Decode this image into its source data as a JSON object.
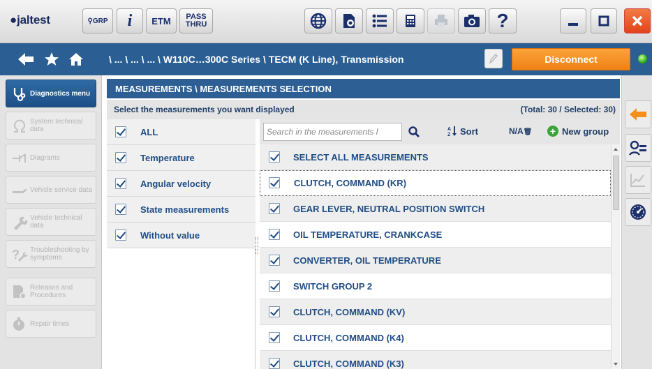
{
  "toolbar": {
    "logo_text": "jaltest",
    "grp_label": "GRP",
    "info_label": "i",
    "etm_label": "ETM",
    "pass_thru_line1": "PASS",
    "pass_thru_line2": "THRU",
    "help_label": "?"
  },
  "nav": {
    "breadcrumb": "\\ ... \\ ... \\ ... \\ W110C…300C Series \\ TECM (K Line), Transmission",
    "disconnect_label": "Disconnect"
  },
  "sidebar": {
    "items": [
      {
        "label": "Diagnostics menu",
        "active": true
      },
      {
        "label": "System technical data",
        "active": false
      },
      {
        "label": "Diagrams",
        "active": false
      },
      {
        "label": "Vehicle service data",
        "active": false
      },
      {
        "label": "Vehicle technical data",
        "active": false
      },
      {
        "label": "Troubleshooting by symptoms",
        "active": false
      },
      {
        "label": "Releases and Procedures",
        "active": false
      },
      {
        "label": "Repair times",
        "active": false
      }
    ]
  },
  "main": {
    "title": "MEASUREMENTS \\ MEASUREMENTS SELECTION",
    "instruction": "Select the measurements you want displayed",
    "totals": "(Total: 30 / Selected: 30)"
  },
  "groups": [
    {
      "label": "ALL",
      "checked": true
    },
    {
      "label": "Temperature",
      "checked": true
    },
    {
      "label": "Angular velocity",
      "checked": true
    },
    {
      "label": "State measurements",
      "checked": true
    },
    {
      "label": "Without value",
      "checked": true
    }
  ],
  "search": {
    "placeholder": "Search in the measurements l...",
    "value": ""
  },
  "list_tools": {
    "sort_label": "Sort",
    "na_label": "N/A",
    "new_group_label": "New group"
  },
  "measurements": [
    {
      "label": "SELECT ALL MEASUREMENTS",
      "checked": true
    },
    {
      "label": "CLUTCH, COMMAND (KR)",
      "checked": true
    },
    {
      "label": "GEAR LEVER, NEUTRAL POSITION SWITCH",
      "checked": true
    },
    {
      "label": "OIL TEMPERATURE, CRANKCASE",
      "checked": true
    },
    {
      "label": "CONVERTER, OIL TEMPERATURE",
      "checked": true
    },
    {
      "label": "SWITCH GROUP 2",
      "checked": true
    },
    {
      "label": "CLUTCH, COMMAND (KV)",
      "checked": true
    },
    {
      "label": "CLUTCH, COMMAND (K4)",
      "checked": true
    },
    {
      "label": "CLUTCH, COMMAND (K3)",
      "checked": true
    }
  ],
  "colors": {
    "brand_blue": "#2b5f94",
    "disconnect_orange": "#f08116",
    "close_red": "#e2431a",
    "text_blue": "#1f4d85"
  }
}
